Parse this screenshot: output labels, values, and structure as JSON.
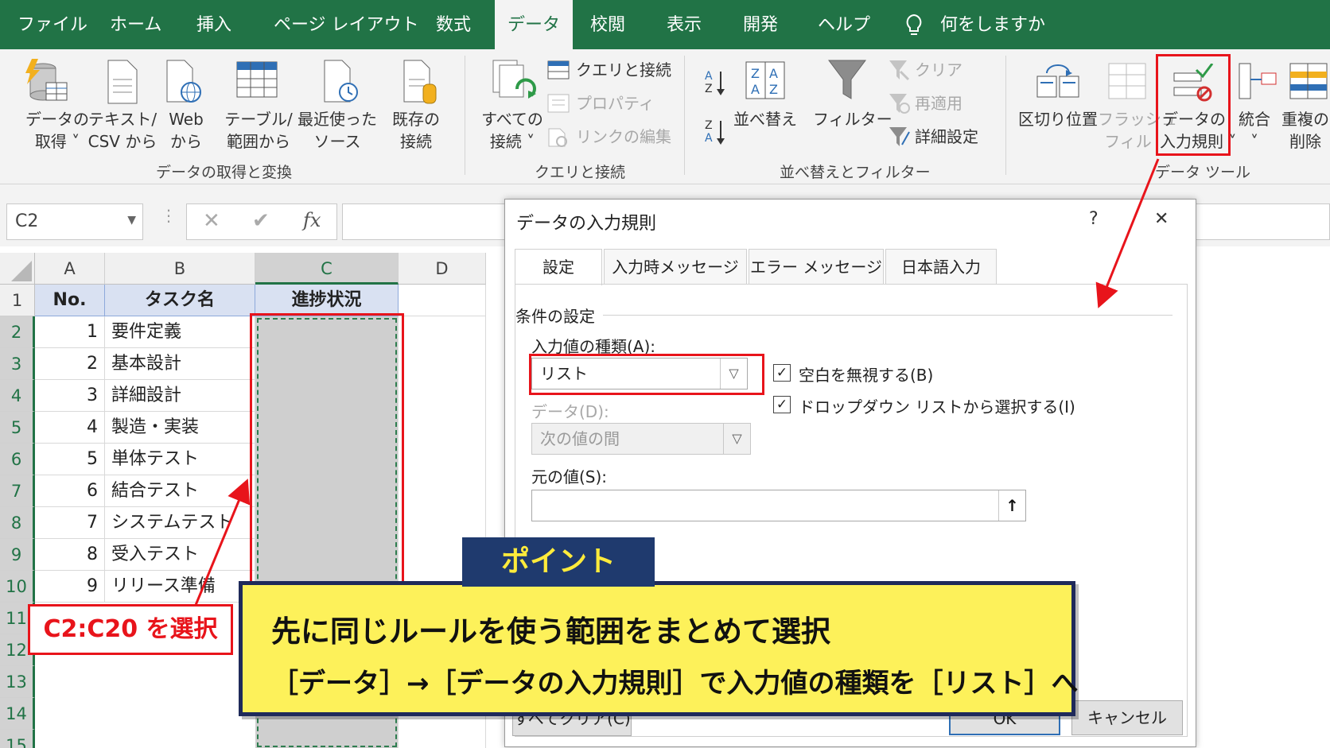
{
  "menu": {
    "file": "ファイル",
    "home": "ホーム",
    "insert": "挿入",
    "page_layout": "ページ レイアウト",
    "formulas": "数式",
    "data": "データ",
    "review": "校閲",
    "view": "表示",
    "developer": "開発",
    "help": "ヘルプ",
    "tell_me": "何をしますか"
  },
  "ribbon": {
    "get_data": [
      "データの",
      "取得 ˅"
    ],
    "text_csv": [
      "テキスト/",
      "CSV から"
    ],
    "web": [
      "Web",
      "から"
    ],
    "table_range": [
      "テーブル/",
      "範囲から"
    ],
    "recent_sources": [
      "最近使った",
      "ソース"
    ],
    "existing_conn": [
      "既存の",
      "接続"
    ],
    "group_get_transform": "データの取得と変換",
    "refresh_all": [
      "すべての",
      "接続 ˅"
    ],
    "queries_conn": "クエリと接続",
    "properties": "プロパティ",
    "edit_links": "リンクの編集",
    "group_queries": "クエリと接続",
    "sort": "並べ替え",
    "filter": "フィルター",
    "clear": "クリア",
    "reapply": "再適用",
    "advanced": "詳細設定",
    "group_sort_filter": "並べ替えとフィルター",
    "text_to_columns": "区切り位置",
    "flash_fill": [
      "フラッシュ",
      "フィル"
    ],
    "data_validation": [
      "データの",
      "入力規則 ˅"
    ],
    "consolidate": [
      "統合",
      "˅"
    ],
    "remove_dup": [
      "重複の",
      "削除"
    ],
    "group_data_tools": "データ ツール"
  },
  "formula_bar": {
    "name_box": "C2",
    "fx": "fx"
  },
  "sheet": {
    "columns": [
      "A",
      "B",
      "C",
      "D"
    ],
    "rows": [
      "1",
      "2",
      "3",
      "4",
      "5",
      "6",
      "7",
      "8",
      "9",
      "10",
      "11",
      "12",
      "13",
      "14",
      "15"
    ],
    "headers": [
      "No.",
      "タスク名",
      "進捗状況"
    ],
    "tasks": [
      {
        "no": "1",
        "name": "要件定義"
      },
      {
        "no": "2",
        "name": "基本設計"
      },
      {
        "no": "3",
        "name": "詳細設計"
      },
      {
        "no": "4",
        "name": "製造・実装"
      },
      {
        "no": "5",
        "name": "単体テスト"
      },
      {
        "no": "6",
        "name": "結合テスト"
      },
      {
        "no": "7",
        "name": "システムテスト"
      },
      {
        "no": "8",
        "name": "受入テスト"
      },
      {
        "no": "9",
        "name": "リリース準備"
      }
    ]
  },
  "dialog": {
    "title": "データの入力規則",
    "help": "?",
    "close": "✕",
    "tabs": [
      "設定",
      "入力時メッセージ",
      "エラー メッセージ",
      "日本語入力"
    ],
    "section": "条件の設定",
    "allow_label": "入力値の種類(A):",
    "allow_value": "リスト",
    "data_label": "データ(D):",
    "data_value": "次の値の間",
    "ignore_blank": "空白を無視する(B)",
    "dropdown": "ドロップダウン リストから選択する(I)",
    "source_label": "元の値(S):",
    "source_value": "",
    "clear_all": "すべてクリア(C)",
    "ok": "OK",
    "cancel": "キャンセル"
  },
  "annotations": {
    "range_label": "C2:C20 を選択",
    "point_tag": "ポイント",
    "point_line1": "先に同じルールを使う範囲をまとめて選択",
    "point_line2": "［データ］→［データの入力規則］で入力値の種類を［リスト］へ"
  },
  "colors": {
    "excel_green": "#217346",
    "highlight_red": "#e8141b",
    "point_yellow": "#fdf15a",
    "point_navy": "#1f2a5a"
  }
}
